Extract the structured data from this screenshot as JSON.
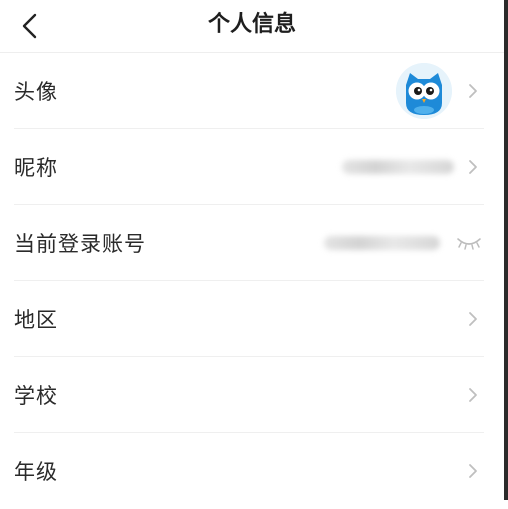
{
  "header": {
    "title": "个人信息",
    "back_icon": "chevron-left-icon"
  },
  "rows": [
    {
      "label": "头像",
      "value_type": "avatar",
      "icon": "owl-avatar-icon"
    },
    {
      "label": "昵称",
      "value_type": "blurred"
    },
    {
      "label": "当前登录账号",
      "value_type": "blurred-with-eye",
      "icon": "eye-closed-icon"
    },
    {
      "label": "地区",
      "value_type": "none"
    },
    {
      "label": "学校",
      "value_type": "none"
    },
    {
      "label": "年级",
      "value_type": "none"
    }
  ],
  "colors": {
    "text": "#2a2a2a",
    "chevron": "#bfbfbf",
    "divider": "#efefef",
    "owl_blue": "#1e8ad8"
  }
}
